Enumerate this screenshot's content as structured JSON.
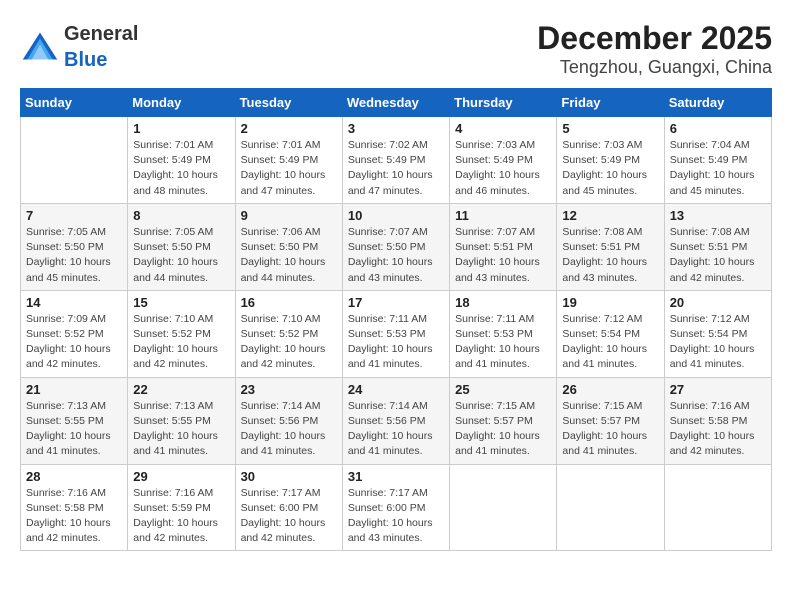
{
  "header": {
    "logo_general": "General",
    "logo_blue": "Blue",
    "title": "December 2025",
    "subtitle": "Tengzhou, Guangxi, China"
  },
  "days_of_week": [
    "Sunday",
    "Monday",
    "Tuesday",
    "Wednesday",
    "Thursday",
    "Friday",
    "Saturday"
  ],
  "weeks": [
    [
      {
        "day": "",
        "info": ""
      },
      {
        "day": "1",
        "info": "Sunrise: 7:01 AM\nSunset: 5:49 PM\nDaylight: 10 hours and 48 minutes."
      },
      {
        "day": "2",
        "info": "Sunrise: 7:01 AM\nSunset: 5:49 PM\nDaylight: 10 hours and 47 minutes."
      },
      {
        "day": "3",
        "info": "Sunrise: 7:02 AM\nSunset: 5:49 PM\nDaylight: 10 hours and 47 minutes."
      },
      {
        "day": "4",
        "info": "Sunrise: 7:03 AM\nSunset: 5:49 PM\nDaylight: 10 hours and 46 minutes."
      },
      {
        "day": "5",
        "info": "Sunrise: 7:03 AM\nSunset: 5:49 PM\nDaylight: 10 hours and 45 minutes."
      },
      {
        "day": "6",
        "info": "Sunrise: 7:04 AM\nSunset: 5:49 PM\nDaylight: 10 hours and 45 minutes."
      }
    ],
    [
      {
        "day": "7",
        "info": "Sunrise: 7:05 AM\nSunset: 5:50 PM\nDaylight: 10 hours and 45 minutes."
      },
      {
        "day": "8",
        "info": "Sunrise: 7:05 AM\nSunset: 5:50 PM\nDaylight: 10 hours and 44 minutes."
      },
      {
        "day": "9",
        "info": "Sunrise: 7:06 AM\nSunset: 5:50 PM\nDaylight: 10 hours and 44 minutes."
      },
      {
        "day": "10",
        "info": "Sunrise: 7:07 AM\nSunset: 5:50 PM\nDaylight: 10 hours and 43 minutes."
      },
      {
        "day": "11",
        "info": "Sunrise: 7:07 AM\nSunset: 5:51 PM\nDaylight: 10 hours and 43 minutes."
      },
      {
        "day": "12",
        "info": "Sunrise: 7:08 AM\nSunset: 5:51 PM\nDaylight: 10 hours and 43 minutes."
      },
      {
        "day": "13",
        "info": "Sunrise: 7:08 AM\nSunset: 5:51 PM\nDaylight: 10 hours and 42 minutes."
      }
    ],
    [
      {
        "day": "14",
        "info": "Sunrise: 7:09 AM\nSunset: 5:52 PM\nDaylight: 10 hours and 42 minutes."
      },
      {
        "day": "15",
        "info": "Sunrise: 7:10 AM\nSunset: 5:52 PM\nDaylight: 10 hours and 42 minutes."
      },
      {
        "day": "16",
        "info": "Sunrise: 7:10 AM\nSunset: 5:52 PM\nDaylight: 10 hours and 42 minutes."
      },
      {
        "day": "17",
        "info": "Sunrise: 7:11 AM\nSunset: 5:53 PM\nDaylight: 10 hours and 41 minutes."
      },
      {
        "day": "18",
        "info": "Sunrise: 7:11 AM\nSunset: 5:53 PM\nDaylight: 10 hours and 41 minutes."
      },
      {
        "day": "19",
        "info": "Sunrise: 7:12 AM\nSunset: 5:54 PM\nDaylight: 10 hours and 41 minutes."
      },
      {
        "day": "20",
        "info": "Sunrise: 7:12 AM\nSunset: 5:54 PM\nDaylight: 10 hours and 41 minutes."
      }
    ],
    [
      {
        "day": "21",
        "info": "Sunrise: 7:13 AM\nSunset: 5:55 PM\nDaylight: 10 hours and 41 minutes."
      },
      {
        "day": "22",
        "info": "Sunrise: 7:13 AM\nSunset: 5:55 PM\nDaylight: 10 hours and 41 minutes."
      },
      {
        "day": "23",
        "info": "Sunrise: 7:14 AM\nSunset: 5:56 PM\nDaylight: 10 hours and 41 minutes."
      },
      {
        "day": "24",
        "info": "Sunrise: 7:14 AM\nSunset: 5:56 PM\nDaylight: 10 hours and 41 minutes."
      },
      {
        "day": "25",
        "info": "Sunrise: 7:15 AM\nSunset: 5:57 PM\nDaylight: 10 hours and 41 minutes."
      },
      {
        "day": "26",
        "info": "Sunrise: 7:15 AM\nSunset: 5:57 PM\nDaylight: 10 hours and 41 minutes."
      },
      {
        "day": "27",
        "info": "Sunrise: 7:16 AM\nSunset: 5:58 PM\nDaylight: 10 hours and 42 minutes."
      }
    ],
    [
      {
        "day": "28",
        "info": "Sunrise: 7:16 AM\nSunset: 5:58 PM\nDaylight: 10 hours and 42 minutes."
      },
      {
        "day": "29",
        "info": "Sunrise: 7:16 AM\nSunset: 5:59 PM\nDaylight: 10 hours and 42 minutes."
      },
      {
        "day": "30",
        "info": "Sunrise: 7:17 AM\nSunset: 6:00 PM\nDaylight: 10 hours and 42 minutes."
      },
      {
        "day": "31",
        "info": "Sunrise: 7:17 AM\nSunset: 6:00 PM\nDaylight: 10 hours and 43 minutes."
      },
      {
        "day": "",
        "info": ""
      },
      {
        "day": "",
        "info": ""
      },
      {
        "day": "",
        "info": ""
      }
    ]
  ]
}
